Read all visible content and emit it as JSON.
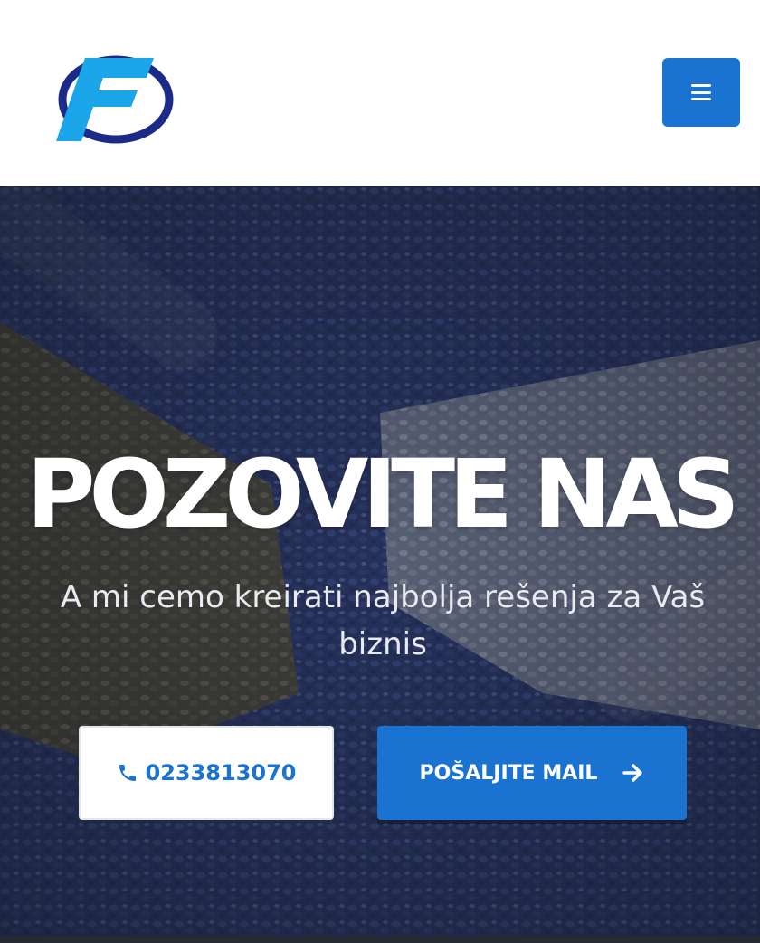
{
  "header": {
    "logo_icon": "company-logo",
    "menu_icon": "hamburger-menu-icon"
  },
  "hero": {
    "title": "POZOVITE NAS",
    "subtitle": "A mi cemo kreirati najbolja rešenja za Vaš biznis",
    "phone_button": {
      "icon": "phone-icon",
      "label": "0233813070"
    },
    "mail_button": {
      "label": "POŠALJITE MAIL",
      "icon": "arrow-right-icon"
    }
  },
  "colors": {
    "accent": "#1a73d1",
    "logo_navy": "#1c2a88",
    "logo_cyan": "#1aa6e8"
  }
}
